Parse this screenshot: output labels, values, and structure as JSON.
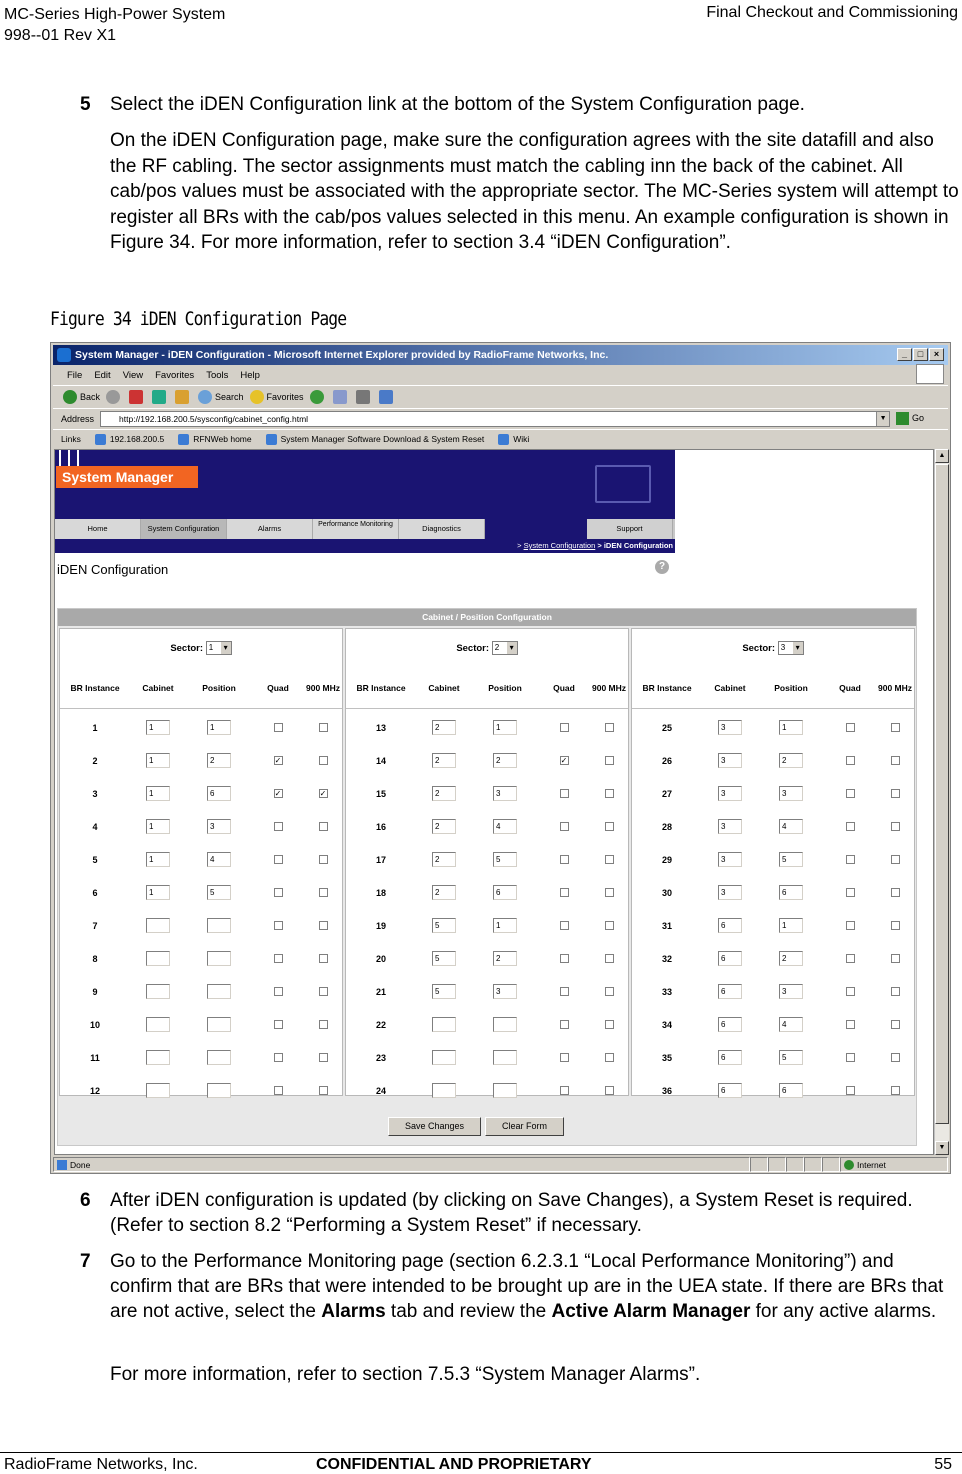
{
  "header": {
    "left_line1": "MC-Series High-Power System",
    "left_line2": "998--01 Rev X1",
    "right": "Final Checkout and Commissioning"
  },
  "step5": {
    "num": "5",
    "text": "Select the iDEN Configuration link at the bottom of the System Configuration page.",
    "para": "On the iDEN Configuration page, make sure the configuration agrees with the site datafill and also the RF cabling. The sector assignments must match the cabling inn the back of the cabinet. All cab/pos values must be associated with the appropriate sector. The MC-Series system will attempt to register all BRs with the cab/pos values selected in this menu. An example configuration is shown in Figure 34. For more information, refer to section 3.4 “iDEN Configuration”."
  },
  "figure_caption": "Figure 34  iDEN Configuration Page",
  "browser": {
    "title": "System Manager - iDEN Configuration - Microsoft Internet Explorer provided by RadioFrame Networks, Inc.",
    "menu": [
      "File",
      "Edit",
      "View",
      "Favorites",
      "Tools",
      "Help"
    ],
    "toolbar": [
      "Back",
      "Search",
      "Favorites"
    ],
    "address_label": "Address",
    "address": "http://192.168.200.5/sysconfig/cabinet_config.html",
    "go": "Go",
    "links_label": "Links",
    "links": [
      "192.168.200.5",
      "RFNWeb home",
      "System Manager Software Download & System Reset",
      "Wiki"
    ],
    "status_left": "Done",
    "status_zone": "Internet"
  },
  "app": {
    "logo": "System Manager",
    "nav": [
      "Home",
      "System Configuration",
      "Alarms",
      "Performance Monitoring",
      "Diagnostics",
      "Support"
    ],
    "crumb_sep": "> ",
    "crumb_link": "System Configuration",
    "crumb_current": " > iDEN Configuration",
    "page_title": "iDEN Configuration",
    "help": "?",
    "panel_title": "Cabinet / Position Configuration",
    "sector_label": "Sector:",
    "col_headers": [
      "BR Instance",
      "Cabinet",
      "Position",
      "Quad",
      "900 MHz"
    ],
    "save_button": "Save Changes",
    "clear_button": "Clear Form",
    "sectors": [
      {
        "sector": "1",
        "rows": [
          {
            "br": "1",
            "cab": "1",
            "pos": "1",
            "quad": false,
            "mhz": false
          },
          {
            "br": "2",
            "cab": "1",
            "pos": "2",
            "quad": true,
            "mhz": false
          },
          {
            "br": "3",
            "cab": "1",
            "pos": "6",
            "quad": true,
            "mhz": true
          },
          {
            "br": "4",
            "cab": "1",
            "pos": "3",
            "quad": false,
            "mhz": false
          },
          {
            "br": "5",
            "cab": "1",
            "pos": "4",
            "quad": false,
            "mhz": false
          },
          {
            "br": "6",
            "cab": "1",
            "pos": "5",
            "quad": false,
            "mhz": false
          },
          {
            "br": "7",
            "cab": "",
            "pos": "",
            "quad": false,
            "mhz": false
          },
          {
            "br": "8",
            "cab": "",
            "pos": "",
            "quad": false,
            "mhz": false
          },
          {
            "br": "9",
            "cab": "",
            "pos": "",
            "quad": false,
            "mhz": false
          },
          {
            "br": "10",
            "cab": "",
            "pos": "",
            "quad": false,
            "mhz": false
          },
          {
            "br": "11",
            "cab": "",
            "pos": "",
            "quad": false,
            "mhz": false
          },
          {
            "br": "12",
            "cab": "",
            "pos": "",
            "quad": false,
            "mhz": false
          }
        ]
      },
      {
        "sector": "2",
        "rows": [
          {
            "br": "13",
            "cab": "2",
            "pos": "1",
            "quad": false,
            "mhz": false
          },
          {
            "br": "14",
            "cab": "2",
            "pos": "2",
            "quad": true,
            "mhz": false
          },
          {
            "br": "15",
            "cab": "2",
            "pos": "3",
            "quad": false,
            "mhz": false
          },
          {
            "br": "16",
            "cab": "2",
            "pos": "4",
            "quad": false,
            "mhz": false
          },
          {
            "br": "17",
            "cab": "2",
            "pos": "5",
            "quad": false,
            "mhz": false
          },
          {
            "br": "18",
            "cab": "2",
            "pos": "6",
            "quad": false,
            "mhz": false
          },
          {
            "br": "19",
            "cab": "5",
            "pos": "1",
            "quad": false,
            "mhz": false
          },
          {
            "br": "20",
            "cab": "5",
            "pos": "2",
            "quad": false,
            "mhz": false
          },
          {
            "br": "21",
            "cab": "5",
            "pos": "3",
            "quad": false,
            "mhz": false
          },
          {
            "br": "22",
            "cab": "",
            "pos": "",
            "quad": false,
            "mhz": false
          },
          {
            "br": "23",
            "cab": "",
            "pos": "",
            "quad": false,
            "mhz": false
          },
          {
            "br": "24",
            "cab": "",
            "pos": "",
            "quad": false,
            "mhz": false
          }
        ]
      },
      {
        "sector": "3",
        "rows": [
          {
            "br": "25",
            "cab": "3",
            "pos": "1",
            "quad": false,
            "mhz": false
          },
          {
            "br": "26",
            "cab": "3",
            "pos": "2",
            "quad": false,
            "mhz": false
          },
          {
            "br": "27",
            "cab": "3",
            "pos": "3",
            "quad": false,
            "mhz": false
          },
          {
            "br": "28",
            "cab": "3",
            "pos": "4",
            "quad": false,
            "mhz": false
          },
          {
            "br": "29",
            "cab": "3",
            "pos": "5",
            "quad": false,
            "mhz": false
          },
          {
            "br": "30",
            "cab": "3",
            "pos": "6",
            "quad": false,
            "mhz": false
          },
          {
            "br": "31",
            "cab": "6",
            "pos": "1",
            "quad": false,
            "mhz": false
          },
          {
            "br": "32",
            "cab": "6",
            "pos": "2",
            "quad": false,
            "mhz": false
          },
          {
            "br": "33",
            "cab": "6",
            "pos": "3",
            "quad": false,
            "mhz": false
          },
          {
            "br": "34",
            "cab": "6",
            "pos": "4",
            "quad": false,
            "mhz": false
          },
          {
            "br": "35",
            "cab": "6",
            "pos": "5",
            "quad": false,
            "mhz": false
          },
          {
            "br": "36",
            "cab": "6",
            "pos": "6",
            "quad": false,
            "mhz": false
          }
        ]
      }
    ]
  },
  "step6": {
    "num": "6",
    "text": "After iDEN configuration is updated (by clicking on Save Changes), a System Reset is required. (Refer to section 8.2 “Performing a System Reset” if necessary."
  },
  "step7": {
    "num": "7",
    "text_a": "Go to the Performance Monitoring page (section 6.2.3.1 “Local Performance Monitoring”) and confirm that are BRs that were intended to be brought up are in the UEA state. If there are BRs that are not active, select the ",
    "bold_a": "Alarms",
    "text_b": " tab and review the ",
    "bold_b": "Active Alarm Manager",
    "text_c": " for any active alarms.",
    "para": "For more information, refer to section 7.5.3 “System Manager Alarms”."
  },
  "footer": {
    "left": "RadioFrame Networks, Inc.",
    "center": "CONFIDENTIAL AND PROPRIETARY",
    "page": "55"
  }
}
